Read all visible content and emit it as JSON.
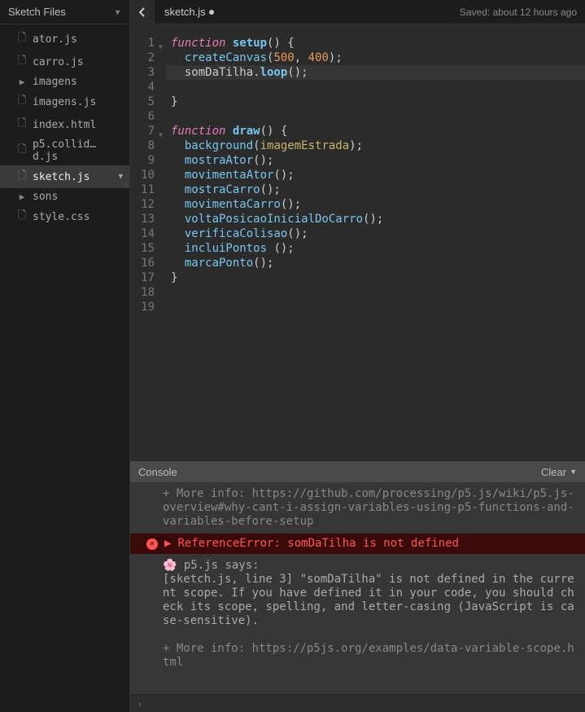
{
  "sidebar": {
    "title": "Sketch Files",
    "items": [
      {
        "icon": "file",
        "label": "ator.js"
      },
      {
        "icon": "file",
        "label": "carro.js"
      },
      {
        "icon": "folder",
        "label": "imagens"
      },
      {
        "icon": "file",
        "label": "imagens.js"
      },
      {
        "icon": "file",
        "label": "index.html"
      },
      {
        "icon": "file",
        "label": "p5.collid…d.js"
      },
      {
        "icon": "file",
        "label": "sketch.js",
        "selected": true
      },
      {
        "icon": "folder",
        "label": "sons"
      },
      {
        "icon": "file",
        "label": "style.css"
      }
    ]
  },
  "header": {
    "tab_name": "sketch.js",
    "dirty": true,
    "saved_text": "Saved: about 12 hours ago"
  },
  "editor": {
    "highlighted_line": 3,
    "foldable_lines": [
      1,
      7
    ],
    "lines": [
      [
        {
          "t": "function ",
          "c": "kw"
        },
        {
          "t": "setup",
          "c": "fn-def"
        },
        {
          "t": "() {",
          "c": "punct"
        }
      ],
      [
        {
          "t": "  ",
          "c": "p"
        },
        {
          "t": "createCanvas",
          "c": "fn-call"
        },
        {
          "t": "(",
          "c": "punct"
        },
        {
          "t": "500",
          "c": "num"
        },
        {
          "t": ", ",
          "c": "punct"
        },
        {
          "t": "400",
          "c": "num"
        },
        {
          "t": ");",
          "c": "punct"
        }
      ],
      [
        {
          "t": "  somDaTilha.",
          "c": "punct"
        },
        {
          "t": "loop",
          "c": "fn-def"
        },
        {
          "t": "();",
          "c": "punct"
        }
      ],
      [
        {
          "t": " ",
          "c": "p"
        }
      ],
      [
        {
          "t": "}",
          "c": "punct"
        }
      ],
      [
        {
          "t": " ",
          "c": "p"
        }
      ],
      [
        {
          "t": "function ",
          "c": "kw"
        },
        {
          "t": "draw",
          "c": "fn-def"
        },
        {
          "t": "() {",
          "c": "punct"
        }
      ],
      [
        {
          "t": "  ",
          "c": "p"
        },
        {
          "t": "background",
          "c": "fn-call"
        },
        {
          "t": "(",
          "c": "punct"
        },
        {
          "t": "imagemEstrada",
          "c": "ident"
        },
        {
          "t": ");",
          "c": "punct"
        }
      ],
      [
        {
          "t": "  ",
          "c": "p"
        },
        {
          "t": "mostraAtor",
          "c": "fn-call"
        },
        {
          "t": "();",
          "c": "punct"
        }
      ],
      [
        {
          "t": "  ",
          "c": "p"
        },
        {
          "t": "movimentaAtor",
          "c": "fn-call"
        },
        {
          "t": "();",
          "c": "punct"
        }
      ],
      [
        {
          "t": "  ",
          "c": "p"
        },
        {
          "t": "mostraCarro",
          "c": "fn-call"
        },
        {
          "t": "();",
          "c": "punct"
        }
      ],
      [
        {
          "t": "  ",
          "c": "p"
        },
        {
          "t": "movimentaCarro",
          "c": "fn-call"
        },
        {
          "t": "();",
          "c": "punct"
        }
      ],
      [
        {
          "t": "  ",
          "c": "p"
        },
        {
          "t": "voltaPosicaoInicialDoCarro",
          "c": "fn-call"
        },
        {
          "t": "();",
          "c": "punct"
        }
      ],
      [
        {
          "t": "  ",
          "c": "p"
        },
        {
          "t": "verificaColisao",
          "c": "fn-call"
        },
        {
          "t": "();",
          "c": "punct"
        }
      ],
      [
        {
          "t": "  ",
          "c": "p"
        },
        {
          "t": "incluiPontos ",
          "c": "fn-call"
        },
        {
          "t": "();",
          "c": "punct"
        }
      ],
      [
        {
          "t": "  ",
          "c": "p"
        },
        {
          "t": "marcaPonto",
          "c": "fn-call"
        },
        {
          "t": "();",
          "c": "punct"
        }
      ],
      [
        {
          "t": "}",
          "c": "punct"
        }
      ],
      [
        {
          "t": " ",
          "c": "p"
        }
      ],
      [
        {
          "t": " ",
          "c": "p"
        }
      ]
    ]
  },
  "console": {
    "title": "Console",
    "clear_label": "Clear",
    "info1_prefix": "+ More info: ",
    "info1_link": "https://github.com/processing/p5.js/wiki/p5.js-overview#why-cant-i-assign-variables-using-p5-functions-and-variables-before-setup",
    "error": "ReferenceError: somDaTilha is not defined",
    "p5_says": "p5.js says:",
    "p5_body": "[sketch.js, line 3] \"somDaTilha\" is not defined in the current scope. If you have defined it in your code, you should check its scope, spelling, and letter-casing (JavaScript is case-sensitive).",
    "info2_prefix": "+ More info: ",
    "info2_link": "https://p5js.org/examples/data-variable-scope.html",
    "prompt": "›"
  }
}
